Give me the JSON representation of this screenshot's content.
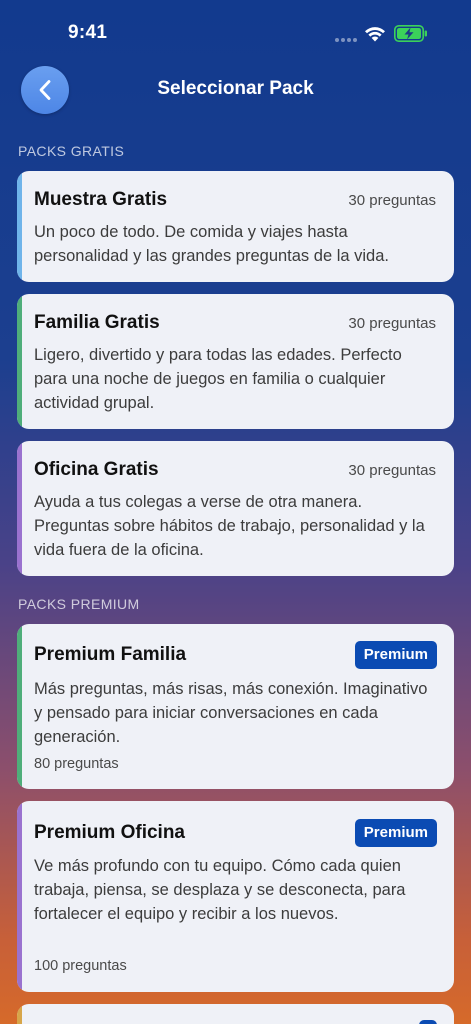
{
  "status_bar": {
    "time": "9:41"
  },
  "nav": {
    "title": "Seleccionar Pack"
  },
  "sections": {
    "free": "PACKS GRATIS",
    "premium": "PACKS PREMIUM"
  },
  "free_packs": [
    {
      "title": "Muestra Gratis",
      "count": "30 preguntas",
      "description": "Un poco de todo. De comida y viajes hasta personalidad y las grandes preguntas de la vida.",
      "accent": "#6fb4ea"
    },
    {
      "title": "Familia Gratis",
      "count": "30 preguntas",
      "description": "Ligero, divertido y para todas las edades. Perfecto para una noche de juegos en familia o cualquier actividad grupal.",
      "accent": "#4fae7a"
    },
    {
      "title": "Oficina Gratis",
      "count": "30 preguntas",
      "description": "Ayuda a tus colegas a verse de otra manera. Preguntas sobre hábitos de trabajo, personalidad y la vida fuera de la oficina.",
      "accent": "#9a72cf"
    }
  ],
  "premium_packs": [
    {
      "title": "Premium Familia",
      "badge": "Premium",
      "description": "Más preguntas, más risas, más conexión. Imaginativo y pensado para iniciar conversaciones en cada generación.",
      "count": "80 preguntas",
      "accent": "#4fae7a"
    },
    {
      "title": "Premium Oficina",
      "badge": "Premium",
      "description": "Ve más profundo con tu equipo. Cómo cada quien trabaja, piensa, se desplaza y se desconecta, para fortalecer el equipo y recibir a los nuevos.",
      "count": "100 preguntas",
      "accent": "#9a72cf"
    }
  ],
  "colors": {
    "badge": "#0b4bb3",
    "card_bg": "#eff1f7",
    "back_button": "#5b93ea",
    "battery": "#3bd15a"
  },
  "icons": {
    "back": "chevron-left-icon",
    "wifi": "wifi-icon",
    "battery": "battery-charging-icon",
    "signal": "signal-dots-icon"
  }
}
